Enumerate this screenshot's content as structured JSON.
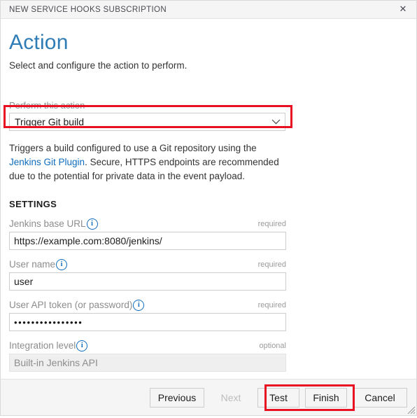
{
  "titlebar": {
    "title": "NEW SERVICE HOOKS SUBSCRIPTION",
    "close_icon": "close-icon",
    "close_glyph": "✕"
  },
  "header": {
    "title": "Action",
    "subtitle": "Select and configure the action to perform."
  },
  "action": {
    "label": "Perform this action",
    "selected": "Trigger Git build",
    "chevron_icon": "chevron-down-icon",
    "highlight_color": "#e81123"
  },
  "description": {
    "lead": "Triggers a build configured to use a Git repository using the ",
    "link_text": "Jenkins Git Plugin",
    "tail": ". Secure, HTTPS endpoints are recommended due to the potential for private data in the event payload.",
    "link_color": "#0f6cbd"
  },
  "settings": {
    "heading": "SETTINGS",
    "info_icon": "info-icon",
    "info_glyph": "i",
    "fields": [
      {
        "label": "Jenkins base URL",
        "requirement": "required",
        "value": "https://example.com:8080/jenkins/",
        "placeholder": "",
        "disabled": false,
        "password": false
      },
      {
        "label": "User name",
        "requirement": "required",
        "value": "user",
        "placeholder": "",
        "disabled": false,
        "password": false
      },
      {
        "label": "User API token (or password)",
        "requirement": "required",
        "value": "••••••••••••••••",
        "placeholder": "",
        "disabled": false,
        "password": true
      },
      {
        "label": "Integration level",
        "requirement": "optional",
        "value": "Built-in Jenkins API",
        "placeholder": "",
        "disabled": true,
        "password": false
      }
    ]
  },
  "footer": {
    "buttons": [
      {
        "label": "Previous",
        "disabled": false,
        "highlighted": false
      },
      {
        "label": "Next",
        "disabled": true,
        "highlighted": false
      },
      {
        "label": "Test",
        "disabled": false,
        "highlighted": true
      },
      {
        "label": "Finish",
        "disabled": false,
        "highlighted": true
      },
      {
        "label": "Cancel",
        "disabled": false,
        "highlighted": false
      }
    ],
    "resize_grip_icon": "resize-grip-icon"
  }
}
